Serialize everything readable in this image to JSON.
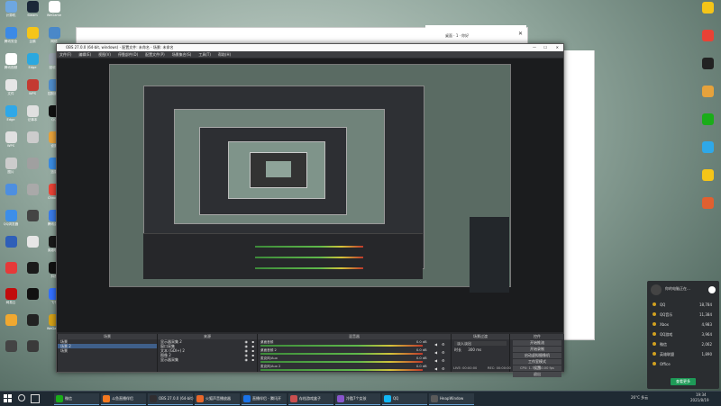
{
  "desktop": {
    "left_icons": [
      {
        "label": "计算机",
        "color": "#6ea7e0"
      },
      {
        "label": "Steam",
        "color": "#1b2838"
      },
      {
        "label": "WeGame",
        "color": "#ffffff"
      },
      {
        "label": "腾讯安全",
        "color": "#3c8ae6"
      },
      {
        "label": "企鹅",
        "color": "#f5c518"
      },
      {
        "label": "网络",
        "color": "#4a88c8"
      },
      {
        "label": "腾讯视频",
        "color": "#ffffff"
      },
      {
        "label": "Edge",
        "color": "#2ba8e0"
      },
      {
        "label": "回收站",
        "color": "#9aa4ad"
      },
      {
        "label": "文件",
        "color": "#e6e6e6"
      },
      {
        "label": "WPS",
        "color": "#c43a31"
      },
      {
        "label": "控制面板",
        "color": "#4f8bc9"
      },
      {
        "label": "Edge",
        "color": "#2fa8e8"
      },
      {
        "label": "记事本",
        "color": "#e0e0e0"
      },
      {
        "label": "QQ",
        "color": "#111111"
      },
      {
        "label": "WPS",
        "color": "#e0e0e0"
      },
      {
        "label": "",
        "color": "#cccccc"
      },
      {
        "label": "设置",
        "color": "#e6a23c"
      },
      {
        "label": "图片",
        "color": "#cccccc"
      },
      {
        "label": "",
        "color": "#a0a0a0"
      },
      {
        "label": "迅雷",
        "color": "#3a8be0"
      },
      {
        "label": "",
        "color": "#4e8fe0"
      },
      {
        "label": "",
        "color": "#a9a9a9"
      },
      {
        "label": "Chrome",
        "color": "#e94235"
      },
      {
        "label": "QQ浏览器",
        "color": "#3d8ee8"
      },
      {
        "label": "",
        "color": "#444444"
      },
      {
        "label": "腾讯会议",
        "color": "#3a7be8"
      },
      {
        "label": "",
        "color": "#2f5fb8"
      },
      {
        "label": "",
        "color": "#e6e6e6"
      },
      {
        "label": "英雄联盟",
        "color": "#1a1a1a"
      },
      {
        "label": "",
        "color": "#e63939"
      },
      {
        "label": "",
        "color": "#1a1a1a"
      },
      {
        "label": "抖音",
        "color": "#111111"
      },
      {
        "label": "网易云",
        "color": "#c20c0c"
      },
      {
        "label": "",
        "color": "#111111"
      },
      {
        "label": "飞书",
        "color": "#3370ff"
      },
      {
        "label": "",
        "color": "#f0a830"
      },
      {
        "label": "",
        "color": "#222222"
      },
      {
        "label": "WeGame",
        "color": "#d4a017"
      },
      {
        "label": "",
        "color": "#444444"
      },
      {
        "label": "",
        "color": "#3a3a3a"
      }
    ],
    "right_icons": [
      {
        "label": "",
        "color": "#f5c518"
      },
      {
        "label": "",
        "color": "#e94235"
      },
      {
        "label": "",
        "color": "#222222"
      },
      {
        "label": "",
        "color": "#e6a23c"
      },
      {
        "label": "",
        "color": "#1aad19"
      },
      {
        "label": "",
        "color": "#2fa8e8"
      },
      {
        "label": "",
        "color": "#f5c518"
      },
      {
        "label": "",
        "color": "#e06030"
      }
    ]
  },
  "obs": {
    "title": "OBS 27.0.0 (64-bit, windows) - 配置文件: 未命名 - 场景: 未命名",
    "menu": [
      "文件(F)",
      "编辑(E)",
      "视图(V)",
      "停靠部件(D)",
      "配置文件(P)",
      "场景集合(S)",
      "工具(T)",
      "帮助(H)"
    ],
    "docks": {
      "scenes": {
        "title": "场景",
        "items": [
          "场景",
          "场景 2",
          "场景"
        ]
      },
      "sources": {
        "title": "来源",
        "items": [
          "显示器采集 2",
          "窗口采集",
          "文本 (GDI+) 2",
          "图像 2",
          "显示器采集"
        ]
      },
      "mixer": {
        "title": "混音器",
        "tracks": [
          {
            "name": "桌面音频",
            "level": "0.0 dB"
          },
          {
            "name": "桌面音频 2",
            "level": "0.0 dB"
          },
          {
            "name": "麦克风/Aux",
            "level": "0.0 dB"
          },
          {
            "name": "麦克风/Aux 2",
            "level": "0.0 dB"
          }
        ]
      },
      "transitions": {
        "title": "场景过渡",
        "type": "淡入淡出",
        "duration_label": "时长",
        "duration": "300 ms"
      },
      "controls": {
        "title": "控件",
        "buttons": [
          "开始推流",
          "开始录制",
          "启动虚拟摄像机",
          "工作室模式",
          "设置",
          "退出"
        ]
      }
    },
    "status": {
      "live": "LIVE: 00:00:00",
      "rec": "REC: 00:00:00",
      "cpu": "CPU: 1.7%, 60.00 fps"
    }
  },
  "notification": {
    "title": "你的电脑正在…",
    "rows": [
      {
        "name": "QQ",
        "value": "18,784"
      },
      {
        "name": "QQ音乐",
        "value": "11,384"
      },
      {
        "name": "Xbox",
        "value": "4,983"
      },
      {
        "name": "QQ游戏",
        "value": "3,964"
      },
      {
        "name": "微信",
        "value": "2,062"
      },
      {
        "name": "英雄联盟",
        "value": "1,890"
      },
      {
        "name": "Office",
        "value": ""
      }
    ],
    "button": "查看更多"
  },
  "taskbar": {
    "items": [
      {
        "label": "微信",
        "color": "#1aad19"
      },
      {
        "label": "斗鱼直播伴侣",
        "color": "#f47920"
      },
      {
        "label": "OBS 27.0.0 (64-bit)",
        "color": "#302e31"
      },
      {
        "label": "火狐声音播放器",
        "color": "#e8672a"
      },
      {
        "label": "直播伴侣 - 腾讯开",
        "color": "#1a73e8"
      },
      {
        "label": "存档游戏盒子",
        "color": "#c94f4f"
      },
      {
        "label": "冷酷7个女孩",
        "color": "#8855cc"
      },
      {
        "label": "QQ",
        "color": "#12b7f5"
      },
      {
        "label": "HeapWindow",
        "color": "#5a5a5a"
      }
    ],
    "tray": {
      "temp": "26°C 多云",
      "time": "19:34",
      "date": "2021/8/19"
    }
  },
  "popup_window": {
    "title": "桌面 · 1 · 你好"
  }
}
